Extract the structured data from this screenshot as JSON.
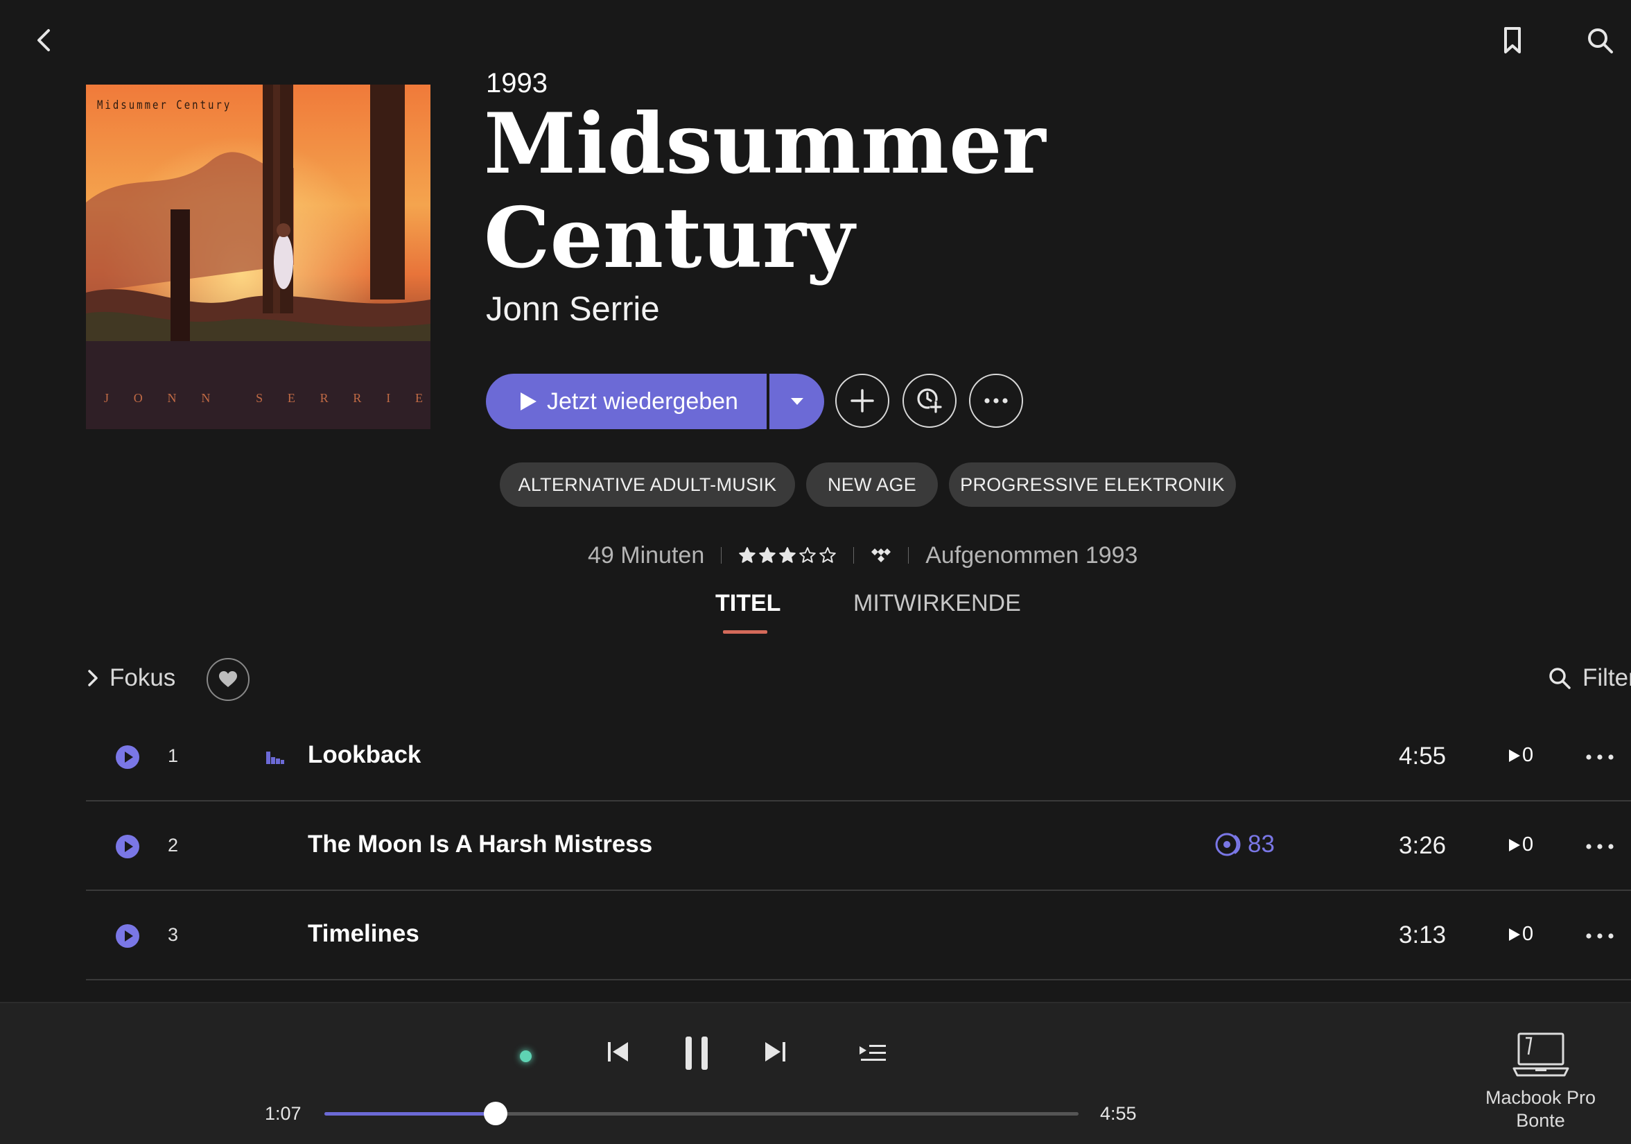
{
  "header": {
    "year": "1993",
    "album_title": "Midsummer Century",
    "artist": "Jonn Serrie"
  },
  "cover": {
    "title_text": "Midsummer Century",
    "artist_letters": [
      "J",
      "O",
      "N",
      "N",
      "S",
      "E",
      "R",
      "R",
      "I",
      "E"
    ]
  },
  "actions": {
    "play_label": "Jetzt wiedergeben",
    "accent_color": "#6c6ad6"
  },
  "genres": [
    "ALTERNATIVE ADULT-MUSIK",
    "NEW AGE",
    "PROGRESSIVE ELEKTRONIK"
  ],
  "meta": {
    "duration": "49 Minuten",
    "rating_stars": 3,
    "rating_max": 5,
    "recorded": "Aufgenommen 1993"
  },
  "tabs": [
    {
      "label": "TITEL",
      "active": true
    },
    {
      "label": "MITWIRKENDE",
      "active": false
    }
  ],
  "filters": {
    "fokus_label": "Fokus",
    "filter_label": "Filter"
  },
  "tracks": [
    {
      "number": "1",
      "title": "Lookback",
      "duration": "4:55",
      "plays": "0",
      "popularity": ""
    },
    {
      "number": "2",
      "title": "The Moon Is A Harsh Mistress",
      "duration": "3:26",
      "plays": "0",
      "popularity": "83"
    },
    {
      "number": "3",
      "title": "Timelines",
      "duration": "3:13",
      "plays": "0",
      "popularity": ""
    }
  ],
  "player": {
    "current_time": "1:07",
    "total_time": "4:55",
    "progress": 0.227,
    "device_name_line1": "Macbook Pro",
    "device_name_line2": "Bonte",
    "status_color": "#5fd3b4"
  }
}
